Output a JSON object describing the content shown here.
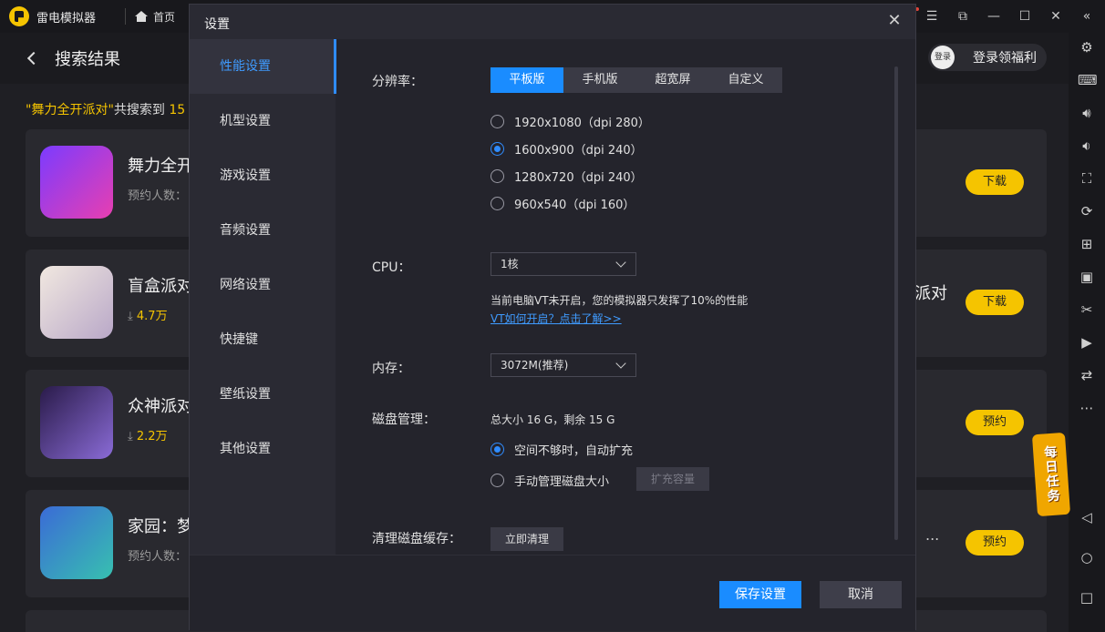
{
  "titlebar": {
    "app_name": "雷电模拟器",
    "home_label": "首页"
  },
  "page": {
    "title": "搜索结果",
    "login_avatar": "登录",
    "login_text": "登录领福利",
    "search_query": "\"舞力全开派对\"",
    "search_prefix": "共搜索到",
    "search_count": "15"
  },
  "cards": [
    {
      "name": "舞力全开",
      "sub_label": "预约人数：",
      "button": "下载"
    },
    {
      "name": "盲盒派对",
      "downloads": "4.7万",
      "extra": "派对",
      "button": "下载"
    },
    {
      "name": "众神派对",
      "downloads": "2.2万",
      "button": "预约"
    },
    {
      "name": "家园：梦",
      "sub_label": "预约人数：",
      "extra": "...",
      "button": "预约"
    }
  ],
  "daily_task": "每日任务",
  "modal": {
    "title": "设置",
    "sidebar": [
      {
        "label": "性能设置",
        "active": true
      },
      {
        "label": "机型设置"
      },
      {
        "label": "游戏设置"
      },
      {
        "label": "音频设置"
      },
      {
        "label": "网络设置"
      },
      {
        "label": "快捷键"
      },
      {
        "label": "壁纸设置"
      },
      {
        "label": "其他设置"
      }
    ],
    "resolution": {
      "label": "分辨率：",
      "tabs": [
        "平板版",
        "手机版",
        "超宽屏",
        "自定义"
      ],
      "active_tab": "平板版",
      "options": [
        "1920x1080（dpi 280）",
        "1600x900（dpi 240）",
        "1280x720（dpi 240）",
        "960x540（dpi 160）"
      ],
      "selected": "1600x900（dpi 240）"
    },
    "cpu": {
      "label": "CPU：",
      "value": "1核",
      "note": "当前电脑VT未开启，您的模拟器只发挥了10%的性能",
      "link": "VT如何开启？点击了解>>"
    },
    "memory": {
      "label": "内存：",
      "value": "3072M(推荐)"
    },
    "disk": {
      "label": "磁盘管理：",
      "info": "总大小 16 G，剩余 15 G",
      "option_auto": "空间不够时，自动扩充",
      "option_manual": "手动管理磁盘大小",
      "expand_button": "扩充容量",
      "selected": "auto"
    },
    "cache": {
      "label": "清理磁盘缓存：",
      "button": "立即清理"
    },
    "footer": {
      "save": "保存设置",
      "cancel": "取消"
    }
  },
  "colors": {
    "accent_blue": "#1a8cff",
    "accent_yellow": "#f5c400",
    "bg_dark": "#24242c"
  }
}
